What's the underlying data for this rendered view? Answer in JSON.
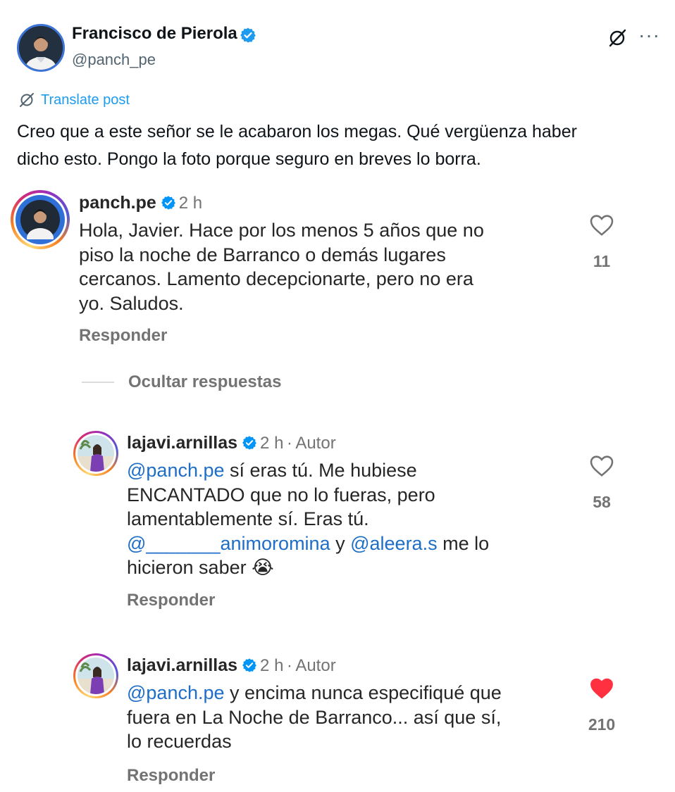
{
  "post": {
    "author_name": "Francisco de Pierola",
    "author_handle": "@panch_pe",
    "translate_label": "Translate post",
    "more_label": "···",
    "text_line1": "Creo que a este señor se le acabaron los megas. Qué vergüenza haber",
    "text_line2": "dicho esto. Pongo la foto porque seguro en breves lo borra."
  },
  "comments": [
    {
      "username": "panch.pe",
      "time": "2 h",
      "lines": [
        "Hola, Javier. Hace por los menos 5 años que no",
        "piso la noche de Barranco o demás lugares",
        "cercanos. Lamento decepcionarte, pero no era",
        "yo. Saludos."
      ],
      "likes": "11",
      "liked": false,
      "reply_label": "Responder"
    },
    {
      "username": "lajavi.arnillas",
      "time": "2 h",
      "separator": "·",
      "author_tag": "Autor",
      "mention": "@panch.pe",
      "line1_rest": " sí eras tú. Me hubiese",
      "line2": "ENCANTADO que no lo fueras, pero",
      "line3": "lamentablemente sí. Eras tú.",
      "mention2": "@_______animoromina",
      "line4_mid": " y ",
      "mention3": "@aleera.s",
      "line4_rest": " me lo",
      "line5": "hicieron saber",
      "emoji": "😭",
      "likes": "58",
      "liked": false,
      "reply_label": "Responder"
    },
    {
      "username": "lajavi.arnillas",
      "time": "2 h",
      "separator": "·",
      "author_tag": "Autor",
      "mention": "@panch.pe",
      "line1_rest": " y encima nunca especifiqué que",
      "line2": "fuera en La Noche de Barranco... así que sí,",
      "line3": "lo recuerdas",
      "likes": "210",
      "liked": true,
      "reply_label": "Responder"
    }
  ],
  "hide_replies_label": "Ocultar respuestas",
  "colors": {
    "x_blue": "#1d9bf0",
    "ig_blue_badge": "#0095f6",
    "mention": "#1e6ec8",
    "like_red": "#ff3040",
    "muted": "#737373"
  },
  "icons": [
    "verified-badge-icon",
    "grok-icon",
    "more-icon",
    "translate-icon",
    "heart-icon",
    "heart-filled-icon"
  ]
}
